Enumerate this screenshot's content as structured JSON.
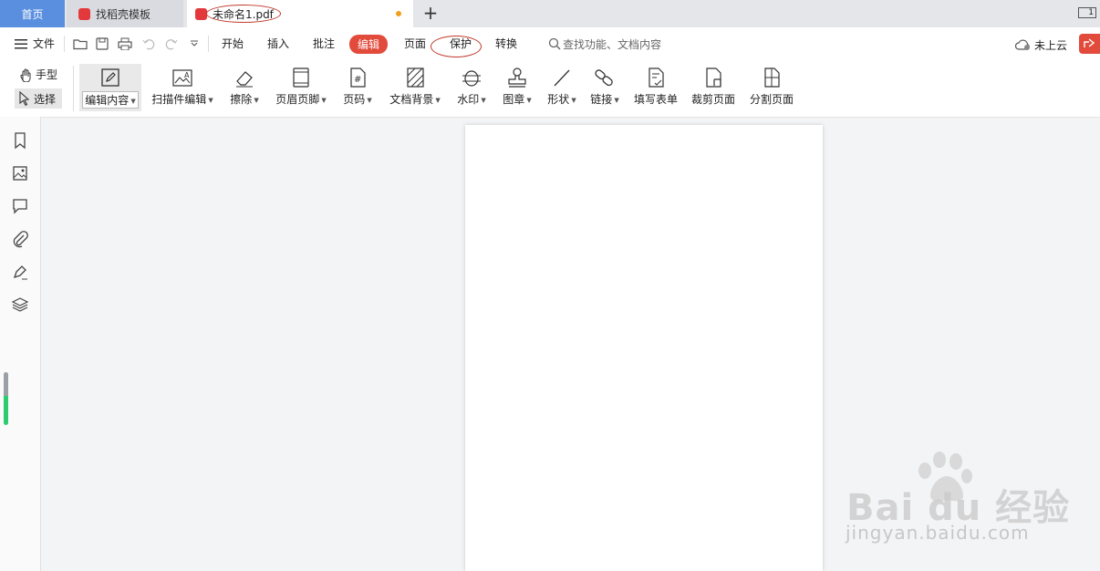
{
  "tabs": {
    "home": "首页",
    "template": "找稻壳模板",
    "document": "未命名1.pdf",
    "window_indicator": "1"
  },
  "menu": {
    "file": "文件",
    "items": [
      "开始",
      "插入",
      "批注",
      "编辑",
      "页面",
      "保护",
      "转换"
    ],
    "active": "编辑",
    "search_placeholder": "查找功能、文档内容",
    "cloud": "未上云"
  },
  "ribbon": {
    "hand": "手型",
    "select": "选择",
    "tools": [
      "编辑内容",
      "扫描件编辑",
      "擦除",
      "页眉页脚",
      "页码",
      "文档背景",
      "水印",
      "图章",
      "形状",
      "链接",
      "填写表单",
      "裁剪页面",
      "分割页面"
    ]
  },
  "sidebar_icons": [
    "bookmark-icon",
    "thumbnail-image-icon",
    "comment-icon",
    "attachment-icon",
    "signature-pen-icon",
    "layers-icon"
  ],
  "colors": {
    "accent": "#e24b3b",
    "home_tab": "#5a8fe0",
    "scroll_indicator": "#2ecc71"
  },
  "watermark": {
    "logo": "Bai du 经验",
    "url": "jingyan.baidu.com"
  }
}
